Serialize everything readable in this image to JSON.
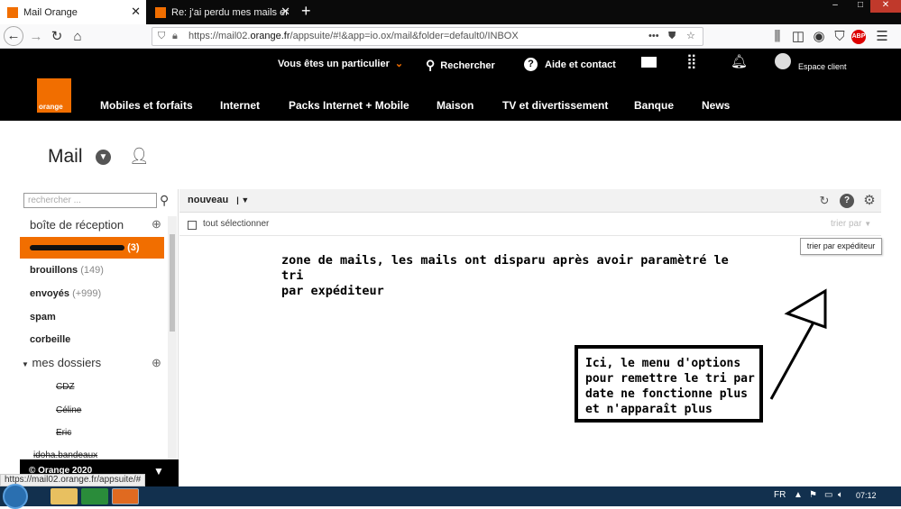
{
  "browser": {
    "tabs": [
      {
        "label": "Mail Orange",
        "active": true
      },
      {
        "label": "Re: j'ai perdu mes mails en les t",
        "active": false
      }
    ],
    "new_tab": "+",
    "url_prefix": "https://mail02.",
    "url_host": "orange.fr",
    "url_path": "/appsuite/#!&app=io.ox/mail&folder=default0/INBOX",
    "url_more": "•••",
    "window_buttons": [
      "–",
      "□",
      "✕"
    ],
    "toolbar_icons": [
      "library-icon",
      "sidebar-icon",
      "account-icon",
      "shield-icon",
      "adblock-icon",
      "menu-icon"
    ],
    "adblock_label": "ABP"
  },
  "header": {
    "particulier": "Vous êtes un particulier",
    "rechercher": "Rechercher",
    "aide": "Aide et contact",
    "espace_client": "Espace client",
    "logo_text": "orange",
    "nav": [
      "Mobiles et forfaits",
      "Internet",
      "Packs Internet + Mobile",
      "Maison",
      "TV et divertissement",
      "Banque",
      "News"
    ]
  },
  "mail": {
    "title": "Mail",
    "search_placeholder": "rechercher ...",
    "inbox_label": "boîte de réception",
    "folders": [
      {
        "label": "",
        "count": "(3)",
        "selected": true
      },
      {
        "label": "brouillons",
        "count": "(149)"
      },
      {
        "label": "envoyés",
        "count": "(+999)"
      },
      {
        "label": "spam",
        "count": ""
      },
      {
        "label": "corbeille",
        "count": ""
      }
    ],
    "my_folders": "mes dossiers",
    "subfolders": [
      "CDZ",
      "Céline",
      "Eric",
      "idoha.bandeaux"
    ],
    "footer": "© Orange 2020",
    "list_sort": "nouveau",
    "select_all": "tout sélectionner",
    "sort_by": "trier par",
    "tooltip": "trier par expéditeur"
  },
  "annotations": {
    "zone_line1": "zone de mails, les mails ont disparu après avoir paramètré le tri",
    "zone_line2": "par expéditeur",
    "box_lines": [
      "Ici, le menu d'options",
      "pour remettre le tri par",
      "date ne fonctionne plus",
      "et n'apparaît plus"
    ]
  },
  "status": {
    "link_url": "https://mail02.orange.fr/appsuite/#"
  },
  "taskbar": {
    "lang": "FR",
    "time": "07:12"
  },
  "colors": {
    "orange": "#f16e00",
    "black": "#000000",
    "taskbar": "#12304e"
  }
}
